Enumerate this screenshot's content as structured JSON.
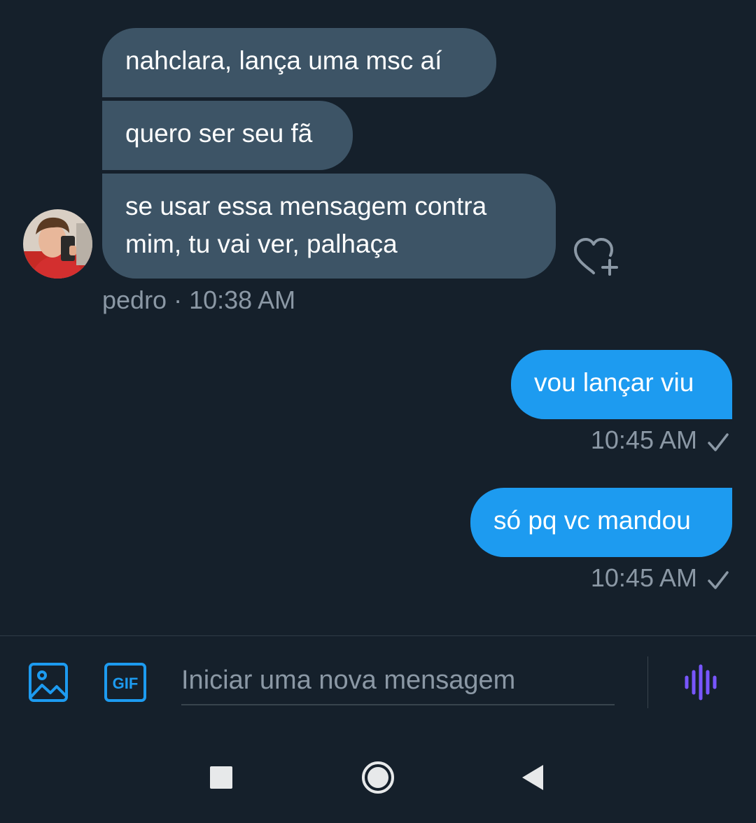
{
  "conversation": {
    "received": [
      {
        "text": "nahclara, lança uma msc aí"
      },
      {
        "text": "quero ser seu fã"
      },
      {
        "text": "se usar essa mensagem contra mim, tu vai ver, palhaça"
      }
    ],
    "received_meta": "pedro · 10:38 AM",
    "sent": [
      {
        "text": "vou lançar viu",
        "time": "10:45 AM"
      },
      {
        "text": "só pq vc mandou",
        "time": "10:45 AM"
      }
    ]
  },
  "composer": {
    "placeholder": "Iniciar uma nova mensagem",
    "gif_label": "GIF"
  },
  "colors": {
    "background": "#15202b",
    "received_bubble": "#3d5466",
    "sent_bubble": "#1d9bf0",
    "accent": "#1d9bf0",
    "voice_icon": "#7856ff",
    "meta_text": "#8b98a5"
  },
  "icons": {
    "media": "image-icon",
    "gif": "gif-icon",
    "voice": "voice-wave-icon",
    "react": "heart-add-icon",
    "read": "check-icon",
    "nav_recent": "square-icon",
    "nav_home": "circle-icon",
    "nav_back": "triangle-back-icon"
  }
}
